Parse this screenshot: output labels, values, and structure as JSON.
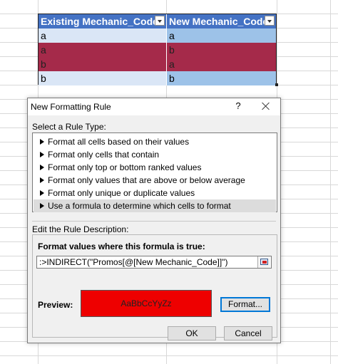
{
  "table": {
    "headers": [
      "Existing Mechanic_Code",
      "New Mechanic_Code"
    ],
    "rows": [
      [
        "a",
        "a"
      ],
      [
        "a",
        "b"
      ],
      [
        "b",
        "a"
      ],
      [
        "b",
        "b"
      ]
    ]
  },
  "dialog": {
    "title": "New Formatting Rule",
    "help_label": "?",
    "select_rule_type_label": "Select a Rule Type:",
    "rule_types": [
      "Format all cells based on their values",
      "Format only cells that contain",
      "Format only top or bottom ranked values",
      "Format only values that are above or below average",
      "Format only unique or duplicate values",
      "Use a formula to determine which cells to format"
    ],
    "edit_description_label": "Edit the Rule Description:",
    "formula_heading": "Format values where this formula is true:",
    "formula_value": ":>INDIRECT(\"Promos[@[New Mechanic_Code]]\")",
    "preview_label": "Preview:",
    "preview_sample": "AaBbCcYyZz",
    "format_button": "Format...",
    "ok_button": "OK",
    "cancel_button": "Cancel"
  },
  "colors": {
    "header_blue": "#4472c4",
    "highlight_red": "#a52a4a",
    "preview_red": "#ee0000",
    "row_light_blue": "#dae6f6"
  },
  "icons": [
    "dropdown-arrow-icon",
    "close-icon",
    "collapse-dialog-icon",
    "triangle-bullet-icon"
  ]
}
